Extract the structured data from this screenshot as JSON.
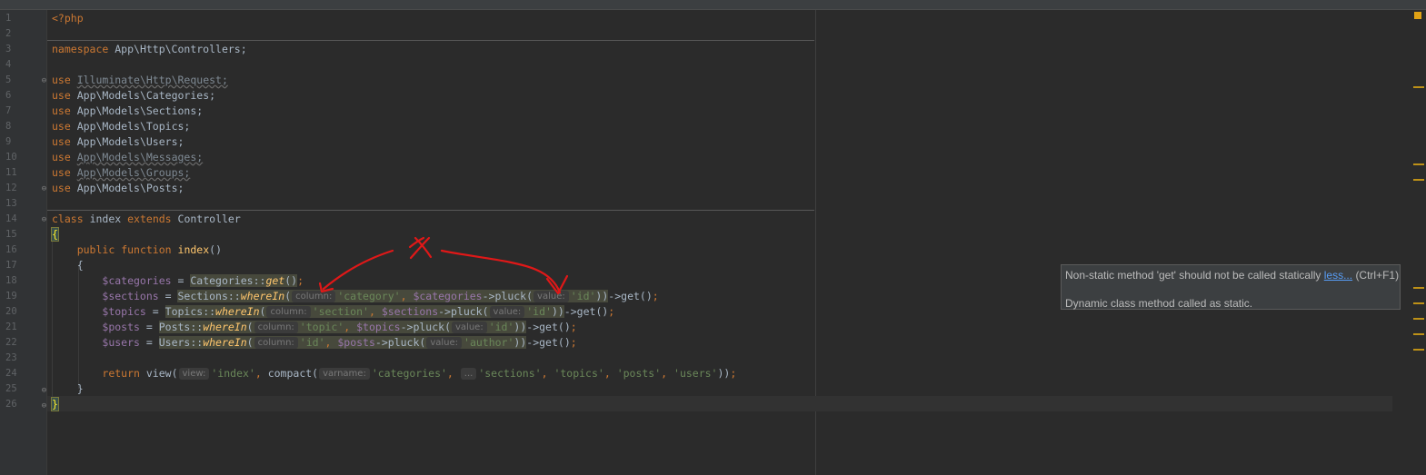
{
  "editor": {
    "line_numbers": [
      "1",
      "2",
      "3",
      "4",
      "5",
      "6",
      "7",
      "8",
      "9",
      "10",
      "11",
      "12",
      "13",
      "14",
      "15",
      "16",
      "17",
      "18",
      "19",
      "20",
      "21",
      "22",
      "23",
      "24",
      "25",
      "26"
    ],
    "code": {
      "php_open": "<?php",
      "namespace_kw": "namespace",
      "namespace_name": "App\\Http\\Controllers;",
      "use_kw": "use",
      "uses": [
        "Illuminate\\Http\\Request;",
        "App\\Models\\Categories;",
        "App\\Models\\Sections;",
        "App\\Models\\Topics;",
        "App\\Models\\Users;",
        "App\\Models\\Messages;",
        "App\\Models\\Groups;",
        "App\\Models\\Posts;"
      ],
      "class_kw": "class",
      "class_name": "index",
      "extends_kw": "extends",
      "parent_class": "Controller",
      "brace_open": "{",
      "brace_close": "}",
      "public_kw": "public",
      "function_kw": "function",
      "function_name": "index",
      "parens": "()",
      "var_categories": "$categories",
      "var_sections": "$sections",
      "var_topics": "$topics",
      "var_posts": "$posts",
      "var_users": "$users",
      "eq": " = ",
      "cls_categories": "Categories",
      "cls_sections": "Sections",
      "cls_topics": "Topics",
      "cls_posts": "Posts",
      "cls_users": "Users",
      "dcolon": "::",
      "get": "get",
      "wherein": "whereIn",
      "pluck": "pluck",
      "arrow": "->",
      "str_category": "'category'",
      "str_section": "'section'",
      "str_topic": "'topic'",
      "str_id": "'id'",
      "str_author": "'author'",
      "str_index": "'index'",
      "str_categories": "'categories'",
      "str_sections": "'sections'",
      "str_topics": "'topics'",
      "str_posts": "'posts'",
      "str_users": "'users'",
      "return_kw": "return",
      "view_fn": "view",
      "compact_fn": "compact"
    },
    "hints": {
      "column": "column:",
      "value": "value:",
      "view": "view:",
      "varname": "varname:",
      "rest": "..."
    }
  },
  "annotation": {
    "handwritten_mark": "X"
  },
  "tooltip": {
    "message": "Non-static method 'get' should not be called statically",
    "link": "less...",
    "shortcut": "(Ctrl+F1)",
    "description": "Dynamic class method called as static."
  },
  "colors": {
    "background": "#2b2b2b",
    "keyword": "#cc7832",
    "string": "#6a8759",
    "variable": "#9876aa",
    "function": "#ffc66d",
    "annotation_red": "#e01818",
    "warning_marker": "#be9117"
  }
}
